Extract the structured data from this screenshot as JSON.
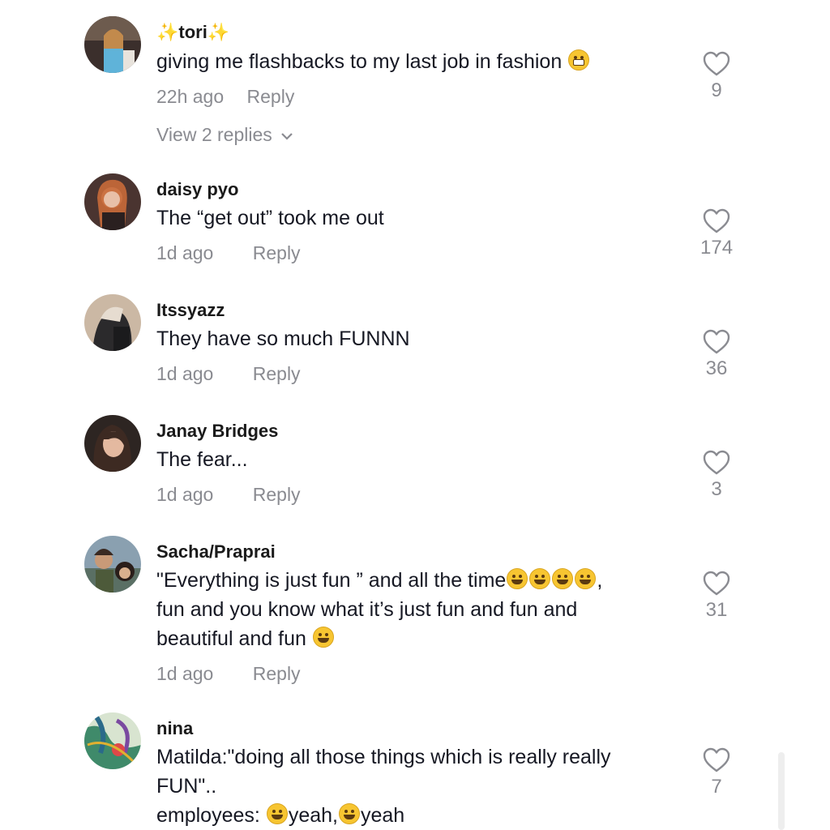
{
  "comments": [
    {
      "username": "tori",
      "text_lines": [
        "giving me flashbacks to my last job in fashion"
      ],
      "emoji_end": "grimace-emoji",
      "time": "22h ago",
      "reply": "Reply",
      "likes": "9",
      "view_replies": "View 2 replies"
    },
    {
      "username": "daisy pyo",
      "text_lines": [
        "The “get out” took me out"
      ],
      "time": "1d ago",
      "reply": "Reply",
      "likes": "174"
    },
    {
      "username": "Itssyazz",
      "text_lines": [
        "They have so much FUNNN"
      ],
      "time": "1d ago",
      "reply": "Reply",
      "likes": "36"
    },
    {
      "username": "Janay Bridges",
      "text_lines": [
        "The fear..."
      ],
      "time": "1d ago",
      "reply": "Reply",
      "likes": "3"
    },
    {
      "username": "Sacha/Praprai",
      "text_lines": [
        "\"Everything is just fun ” and all the time",
        "fun and you know what it’s just fun and fun and",
        "beautiful and fun"
      ],
      "time": "1d ago",
      "reply": "Reply",
      "likes": "31"
    },
    {
      "username": "nina",
      "text_lines": [
        "Matilda:\"doing all those things which is really really",
        "FUN\"..",
        "employees:"
      ],
      "line3_parts": [
        "yeah,",
        "yeah"
      ],
      "likes": "7"
    }
  ],
  "colors": {
    "text": "#161823",
    "secondary": "#8a8b91",
    "sparkle": "#f5c542"
  }
}
